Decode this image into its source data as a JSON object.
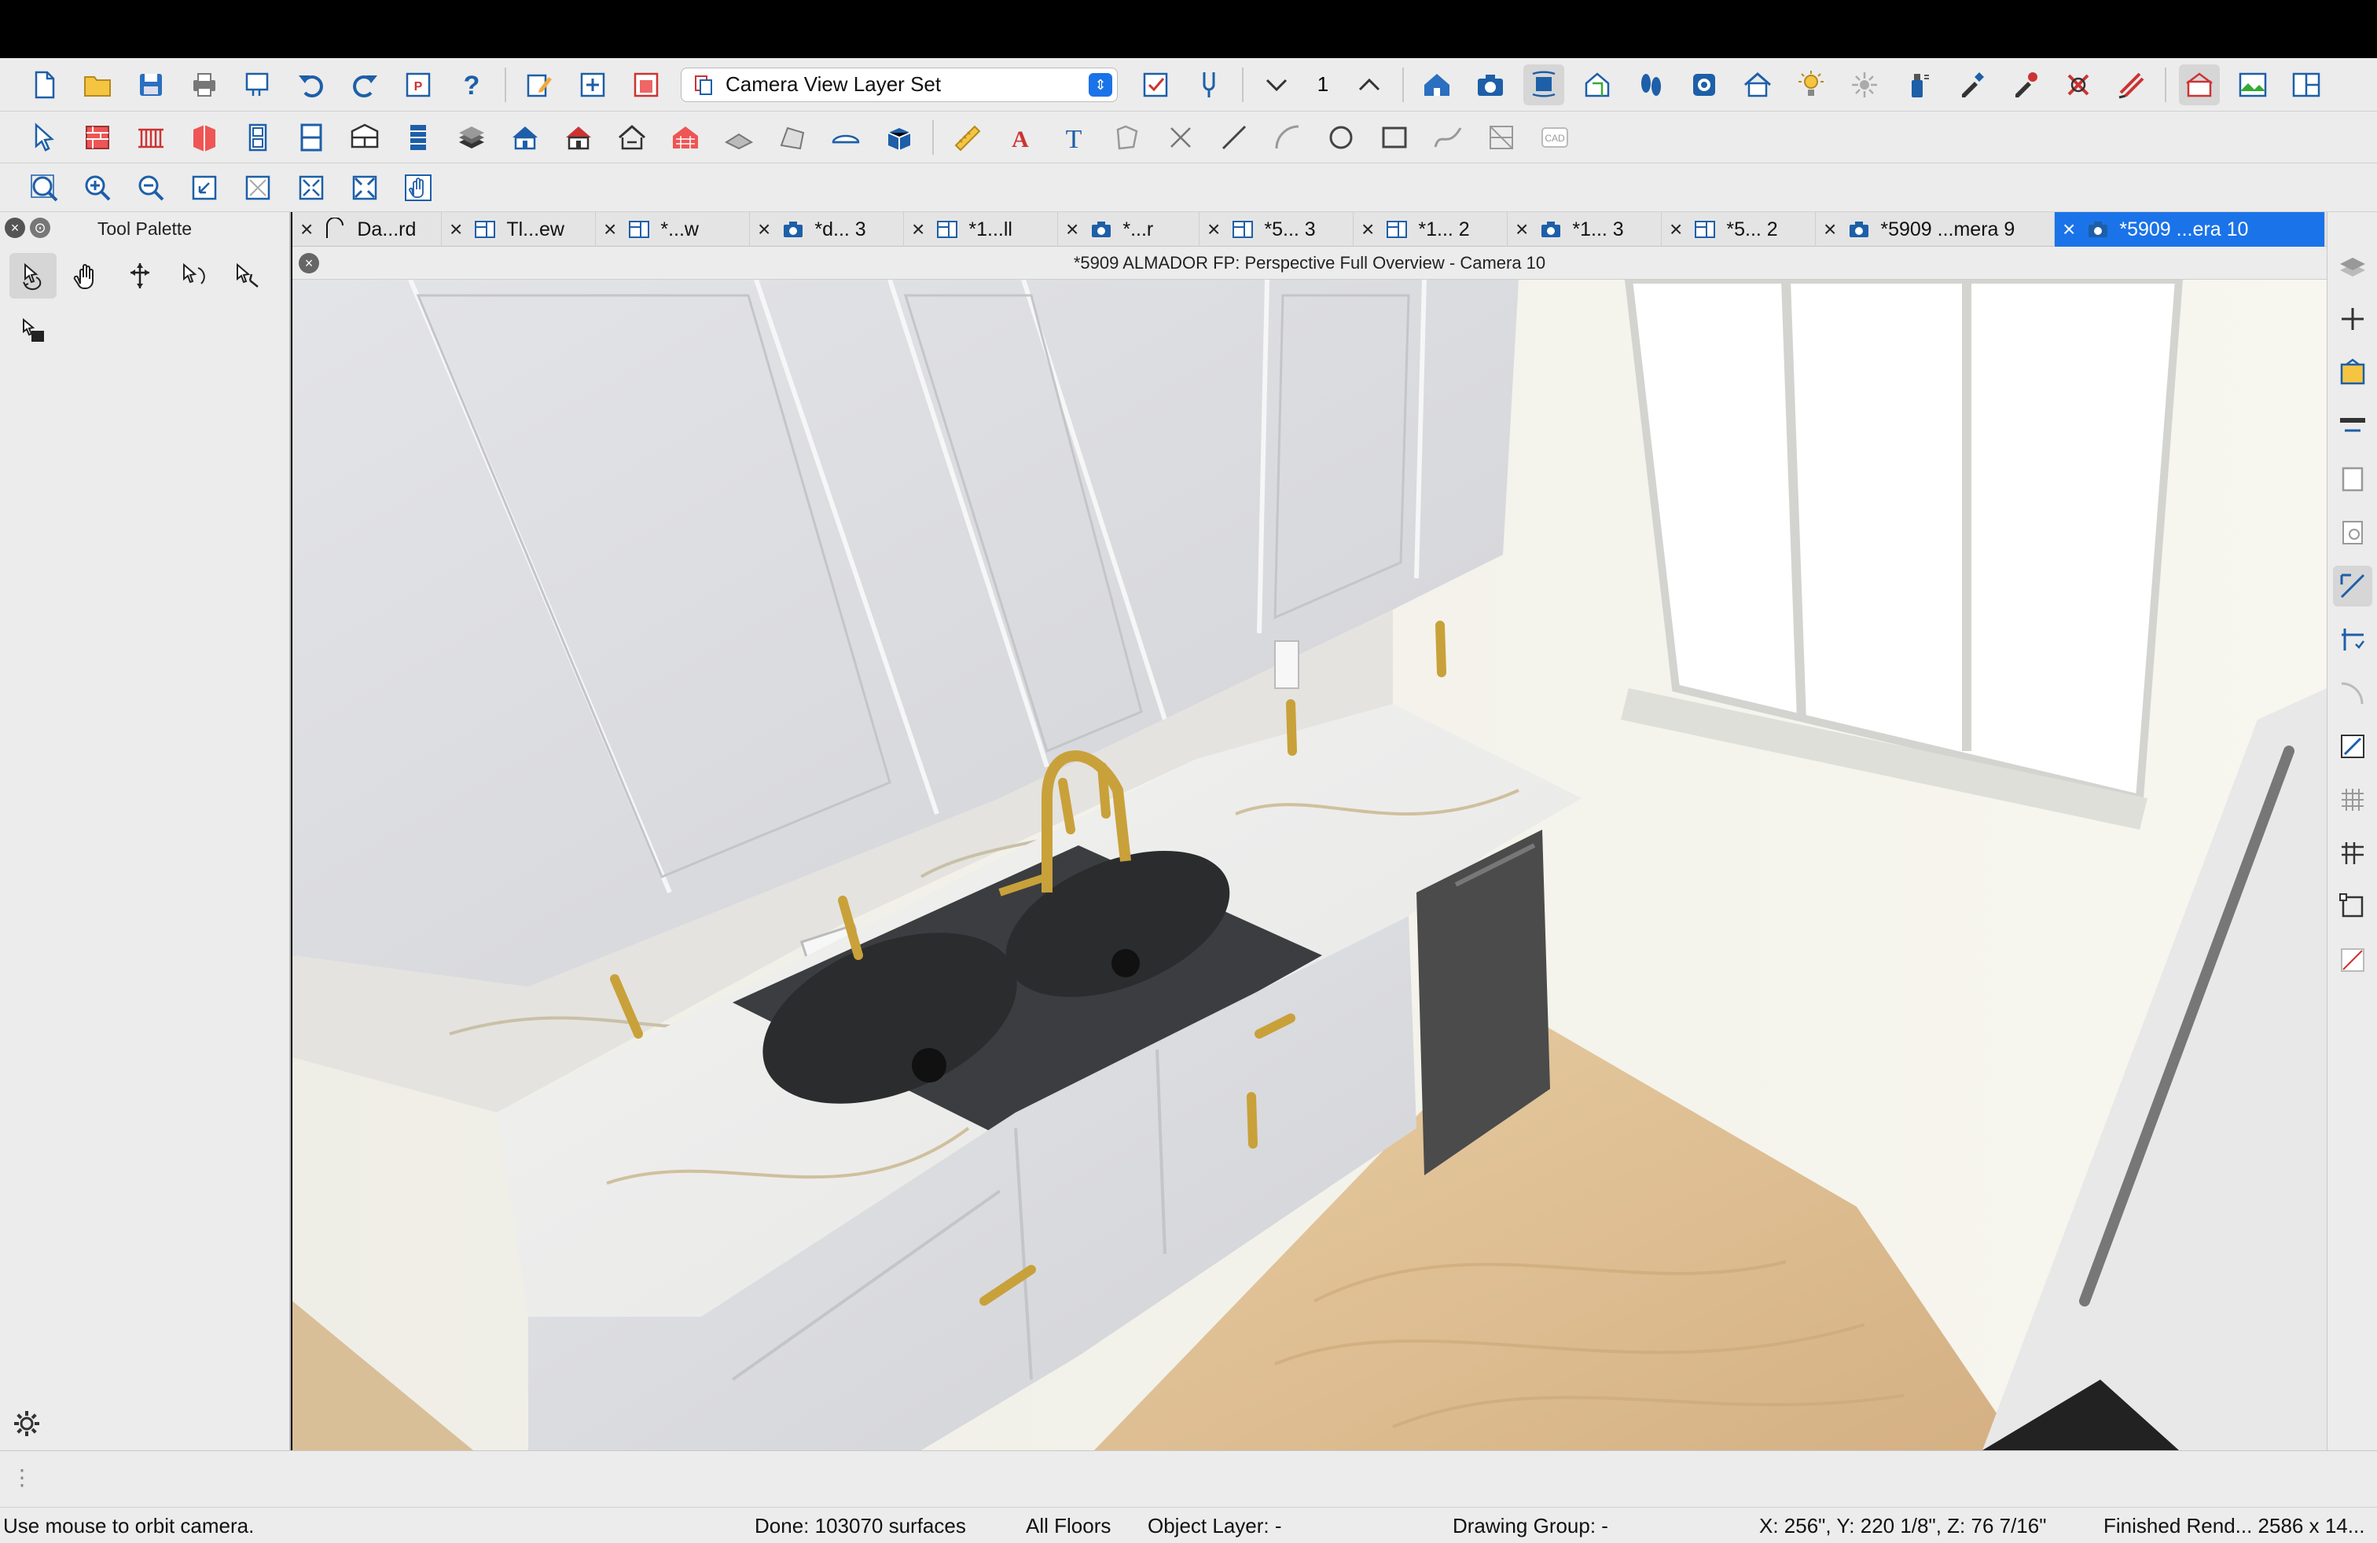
{
  "toolbar1": {
    "layer_set": {
      "selected": "Camera View Layer Set"
    },
    "floor_number": "1"
  },
  "palette": {
    "title": "Tool Palette"
  },
  "tabs": [
    {
      "label": "Da...rd",
      "icon": "elevation-icon"
    },
    {
      "label": "Tl...ew",
      "icon": "plan-view-icon"
    },
    {
      "label": "*...w",
      "icon": "plan-view-icon"
    },
    {
      "label": "*d... 3",
      "icon": "camera-icon"
    },
    {
      "label": "*1...ll",
      "icon": "plan-view-icon"
    },
    {
      "label": "*...r",
      "icon": "camera-icon"
    },
    {
      "label": "*5... 3",
      "icon": "plan-view-icon"
    },
    {
      "label": "*1... 2",
      "icon": "plan-view-icon"
    },
    {
      "label": "*1... 3",
      "icon": "camera-icon"
    },
    {
      "label": "*5... 2",
      "icon": "plan-view-icon"
    },
    {
      "label": "*5909 ...mera 9",
      "icon": "camera-icon"
    },
    {
      "label": "*5909 ...era 10",
      "icon": "camera-icon",
      "active": true
    }
  ],
  "view": {
    "title": "*5909 ALMADOR FP: Perspective Full Overview - Camera 10"
  },
  "status": {
    "hint": "Use mouse to orbit camera.",
    "done": "Done:  103070 surfaces",
    "floors": "All Floors",
    "object_layer": "Object Layer: -",
    "drawing_group": "Drawing Group: -",
    "coords": "X: 256\", Y: 220 1/8\", Z: 76 7/16\"",
    "render": "Finished Rend...  2586 x 14..."
  },
  "colors": {
    "accent": "#1a73e8",
    "cabinet": "#dcdde0",
    "wall": "#f4f3ec",
    "floor": "#ddbf95",
    "brass": "#c9a13a",
    "sink": "#3c3d40"
  }
}
